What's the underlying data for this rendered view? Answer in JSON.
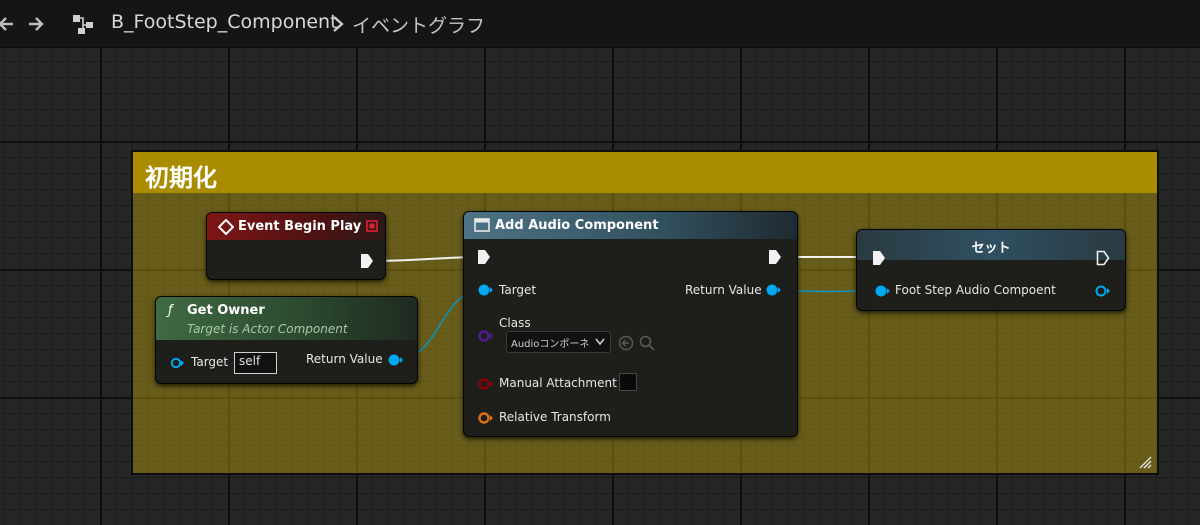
{
  "breadcrumb": {
    "asset_name": "B_FootStep_Component",
    "graph_name": "イベントグラフ"
  },
  "comment": {
    "title": "初期化"
  },
  "nodes": {
    "event_begin_play": {
      "title": "Event Begin Play"
    },
    "get_owner": {
      "title": "Get Owner",
      "subtitle": "Target is Actor Component",
      "target_label": "Target",
      "target_value": "self",
      "return_label": "Return Value"
    },
    "add_audio_component": {
      "title": "Add Audio Component",
      "target_label": "Target",
      "return_label": "Return Value",
      "class_label": "Class",
      "class_value": "Audioコンポーネ",
      "manual_attachment_label": "Manual Attachment",
      "relative_transform_label": "Relative Transform"
    },
    "set_node": {
      "title": "セット",
      "variable_label": "Foot Step Audio Compoent"
    }
  },
  "colors": {
    "comment_header": "#a98c00",
    "comment_body": "#7a6a0a",
    "object_pin": "#00a8f0",
    "class_pin": "#5a1a98",
    "bool_pin": "#8c0000",
    "transform_pin": "#e07010",
    "event_header": "#7f1616",
    "function_header": "#3f6a43",
    "add_component_header": "#4d7486"
  }
}
